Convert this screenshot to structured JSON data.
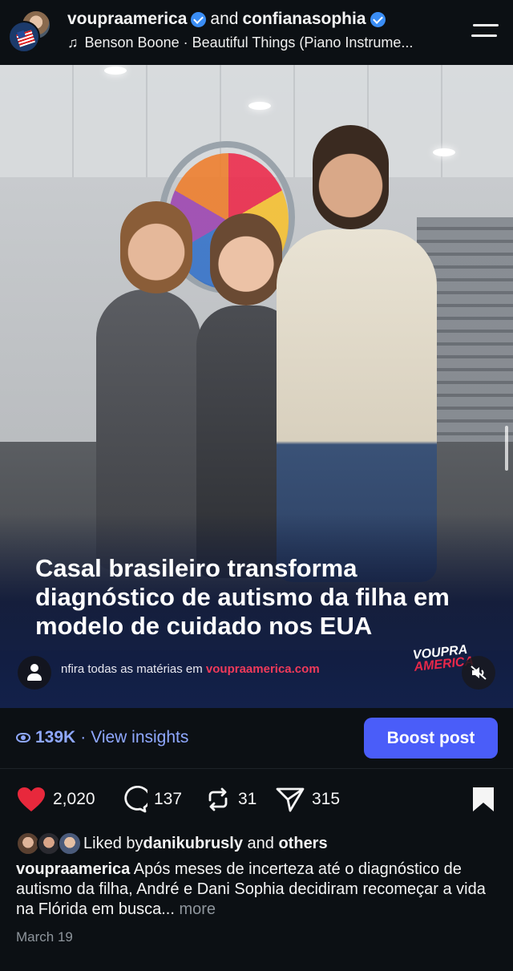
{
  "header": {
    "author_1": "voupraamerica",
    "joiner": "and",
    "author_2": "confianasophia",
    "music": "Benson Boone · Beautiful Things (Piano Instrume..."
  },
  "post": {
    "headline": "Casal brasileiro transforma diagnóstico de autismo da filha em modelo de cuidado nos EUA",
    "subline_prefix": "nfira todas as matérias em ",
    "subline_site": "voupraamerica.com",
    "brand_top": "VOUPRA",
    "brand_bottom": "AMERICA"
  },
  "insights": {
    "views": "139K",
    "separator": "·",
    "link_label": "View insights",
    "boost_label": "Boost post"
  },
  "actions": {
    "likes": "2,020",
    "comments": "137",
    "reposts": "31",
    "shares": "315"
  },
  "liked_by": {
    "prefix": "Liked by ",
    "user": "danikubrusly",
    "middle": " and ",
    "others": "others"
  },
  "caption": {
    "user": "voupraamerica",
    "text": " Após meses de incerteza até o diagnóstico de autismo da filha, André e Dani Sophia decidiram recomeçar a vida na Flórida em busca... ",
    "more": "more"
  },
  "date": "March 19",
  "colors": {
    "accent": "#4a5df9",
    "link": "#8fa8ff",
    "like": "#e8283c",
    "verified": "#3a8df5"
  }
}
